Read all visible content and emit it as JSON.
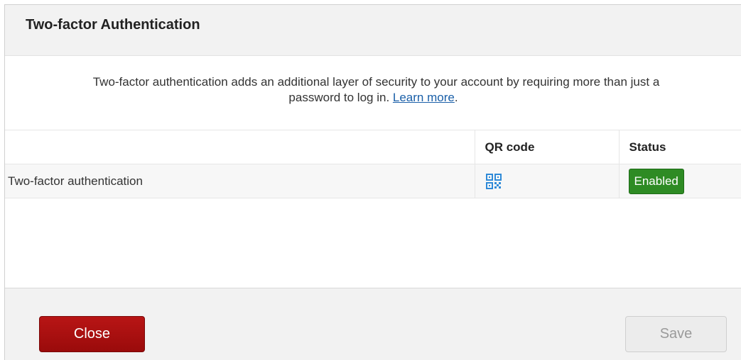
{
  "dialog": {
    "title": "Two-factor Authentication",
    "description_line1": "Two-factor authentication adds an additional layer of security to your account by requiring more than just a",
    "description_line2_prefix": "password to log in. ",
    "learn_more_label": "Learn more",
    "description_line2_suffix": "."
  },
  "table": {
    "columns": [
      "",
      "QR code",
      "Status"
    ],
    "rows": [
      {
        "name": "Two-factor authentication",
        "qr_icon": "qr-code-icon",
        "status": "Enabled"
      }
    ]
  },
  "footer": {
    "close_label": "Close",
    "save_label": "Save"
  },
  "colors": {
    "accent_red": "#a50e0e",
    "status_green": "#2e8b24",
    "link_blue": "#1a5fa8",
    "qr_icon_blue": "#2f8ad8"
  }
}
